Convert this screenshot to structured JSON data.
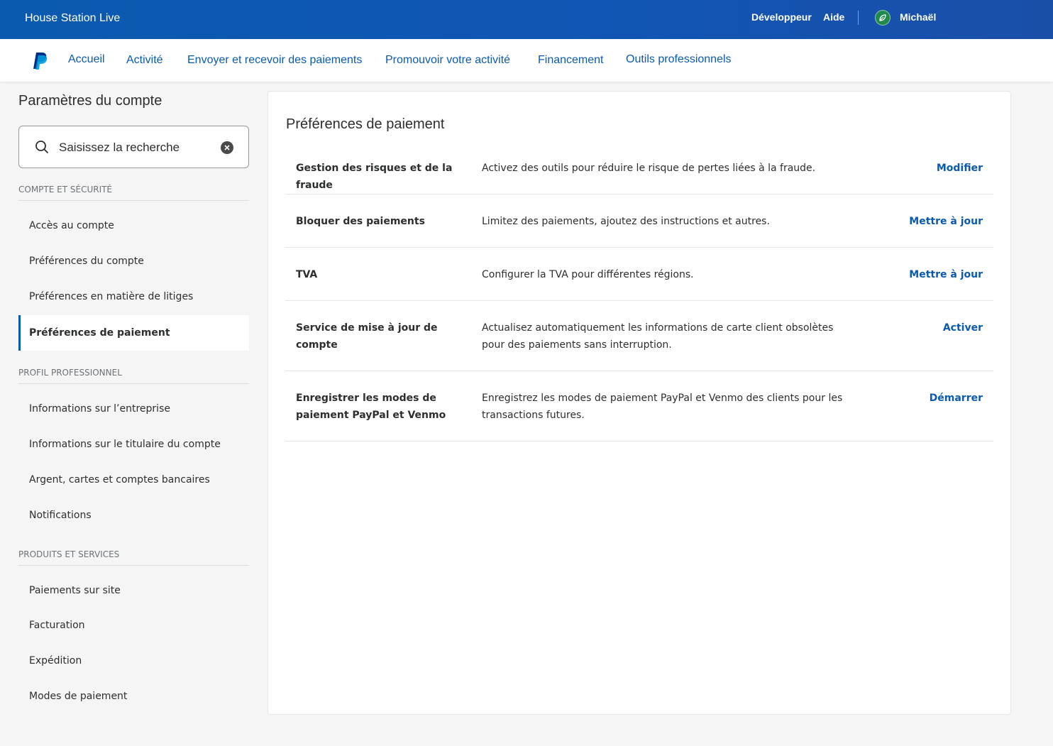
{
  "topbar": {
    "brand": "House Station Live",
    "developer": "Développeur",
    "help": "Aide",
    "user": "Michaël"
  },
  "nav": {
    "items": [
      {
        "label": "Accueil"
      },
      {
        "label": "Activité"
      },
      {
        "label": "Envoyer et recevoir des paiements"
      },
      {
        "label": "Promouvoir votre activité"
      },
      {
        "label": "Financement"
      },
      {
        "label": "Outils professionnels"
      }
    ]
  },
  "sidebar": {
    "title": "Paramètres du compte",
    "search_placeholder": "Saisissez la recherche",
    "sections": [
      {
        "label": "COMPTE ET SÉCURITÉ",
        "items": [
          {
            "label": "Accès au compte"
          },
          {
            "label": "Préférences du compte"
          },
          {
            "label": "Préférences en matière de litiges"
          },
          {
            "label": "Préférences de paiement",
            "active": true
          }
        ]
      },
      {
        "label": "PROFIL PROFESSIONNEL",
        "items": [
          {
            "label": "Informations sur l’entreprise"
          },
          {
            "label": "Informations sur le titulaire du compte"
          },
          {
            "label": "Argent, cartes et comptes bancaires"
          },
          {
            "label": "Notifications"
          }
        ]
      },
      {
        "label": "PRODUITS ET SERVICES",
        "items": [
          {
            "label": "Paiements sur site"
          },
          {
            "label": "Facturation"
          },
          {
            "label": "Expédition"
          },
          {
            "label": "Modes de paiement"
          }
        ]
      }
    ]
  },
  "main": {
    "title": "Préférences de paiement",
    "rows": [
      {
        "name": "Gestion des risques et de la fraude",
        "description": "Activez des outils pour réduire le risque de pertes liées à la fraude.",
        "action": "Modifier"
      },
      {
        "name": "Bloquer des paiements",
        "description": "Limitez des paiements, ajoutez des instructions et autres.",
        "action": "Mettre à jour"
      },
      {
        "name": "TVA",
        "description": "Configurer la TVA pour différentes régions.",
        "action": "Mettre à jour"
      },
      {
        "name": "Service de mise à jour de compte",
        "description": "Actualisez automatiquement les informations de carte client obsolètes pour des paiements sans interruption.",
        "action": "Activer"
      },
      {
        "name": "Enregistrer les modes de paiement PayPal et Venmo",
        "description": "Enregistrez les modes de paiement PayPal et Venmo des clients pour les transactions futures.",
        "action": "Démarrer"
      }
    ]
  },
  "colors": {
    "topbar": "#0a5ab0",
    "link": "#0a5ab0",
    "background": "#f5f5f5"
  }
}
